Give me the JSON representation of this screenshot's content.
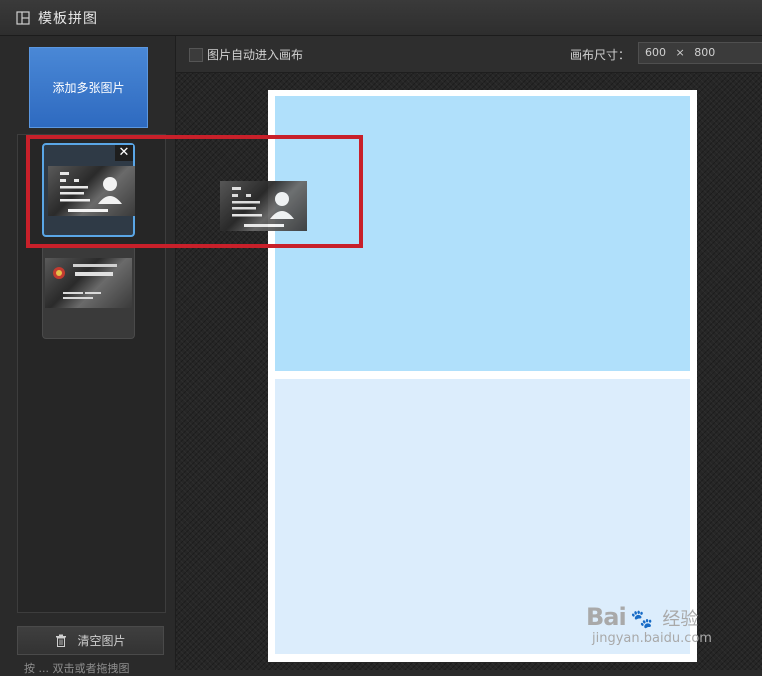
{
  "window": {
    "title": "模板拼图",
    "icon": "layout-grid-icon"
  },
  "sidebar": {
    "add_button_label": "添加多张图片",
    "thumbnails": [
      {
        "name": "id-card-back",
        "selected": true,
        "close_label": "✕"
      },
      {
        "name": "id-card-front",
        "selected": false
      }
    ],
    "clear_button_label": "清空图片",
    "hint_text": "按 ... 双击或者拖拽图"
  },
  "toolbar": {
    "auto_enter_label": "图片自动进入画布",
    "auto_enter_checked": false,
    "size_label": "画布尺寸：",
    "size_width": "600",
    "size_x": "×",
    "size_height": "800"
  },
  "canvas": {
    "top_cell_color": "#b0e0fb",
    "bottom_cell_color": "#dcedfc"
  },
  "annotation": {
    "color": "#c8202a"
  },
  "watermark": {
    "logo": "Bai",
    "logo_suffix": "经验",
    "url": "jingyan.baidu.com"
  }
}
